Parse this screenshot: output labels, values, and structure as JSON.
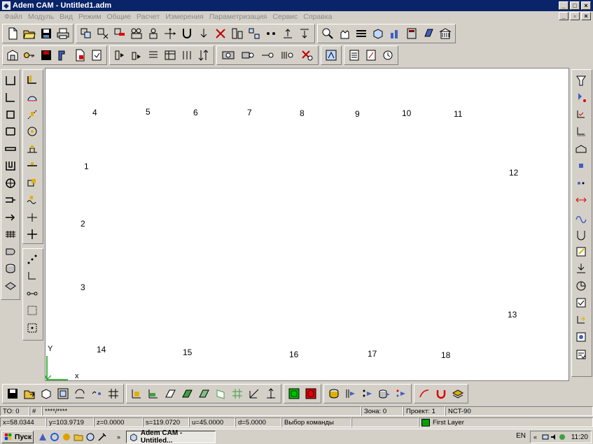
{
  "window": {
    "title": "Adem CAM - Untitled1.adm"
  },
  "menu": [
    "Файл",
    "Модуль",
    "Вид",
    "Режим",
    "Общие",
    "Расчет",
    "Измерения",
    "Параметризация",
    "Сервис",
    "Справка"
  ],
  "canvas": {
    "labels": [
      {
        "text": "1"
      },
      {
        "text": "2"
      },
      {
        "text": "3"
      },
      {
        "text": "4"
      },
      {
        "text": "5"
      },
      {
        "text": "6"
      },
      {
        "text": "7"
      },
      {
        "text": "8"
      },
      {
        "text": "9"
      },
      {
        "text": "10"
      },
      {
        "text": "11"
      },
      {
        "text": "12"
      },
      {
        "text": "13"
      },
      {
        "text": "14"
      },
      {
        "text": "15"
      },
      {
        "text": "16"
      },
      {
        "text": "17"
      },
      {
        "text": "18"
      }
    ],
    "axis_y": "Y",
    "axis_x": "x"
  },
  "status": {
    "to": "TO: 0",
    "hash": "#",
    "mask": "****/****",
    "zone": "Зона: 0",
    "project": "Проект: 1",
    "machine": "NCT-90",
    "x": "x=58.0344",
    "y": "y=103.9719",
    "z": "z=0.0000",
    "s": "s=119.0720",
    "u": "u=45.0000",
    "d": "d=5.0000",
    "command": "Выбор команды",
    "layer": "First Layer",
    "layer_color": "#00a000"
  },
  "taskbar": {
    "start": "Пуск",
    "task": "Adem CAM - Untitled...",
    "lang": "EN",
    "clock": "11:20"
  }
}
